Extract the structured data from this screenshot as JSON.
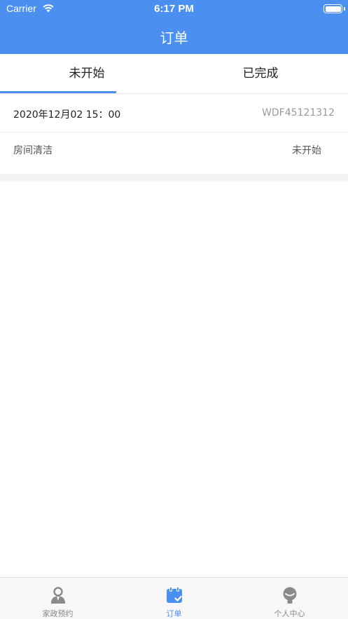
{
  "status_bar": {
    "carrier": "Carrier",
    "time": "6:17 PM"
  },
  "nav": {
    "title": "订单"
  },
  "tabs": [
    {
      "label": "未开始",
      "selected": true
    },
    {
      "label": "已完成",
      "selected": false
    }
  ],
  "orders": [
    {
      "datetime": "2020年12月02  15：00",
      "order_no": "WDF45121312",
      "service": "房间清洁",
      "status": "未开始"
    }
  ],
  "tabbar": [
    {
      "label": "家政预约",
      "icon": "person-icon",
      "active": false
    },
    {
      "label": "订单",
      "icon": "calendar-check-icon",
      "active": true
    },
    {
      "label": "个人中心",
      "icon": "profile-icon",
      "active": false
    }
  ],
  "colors": {
    "accent": "#4b8ff0",
    "inactive": "#888888"
  }
}
